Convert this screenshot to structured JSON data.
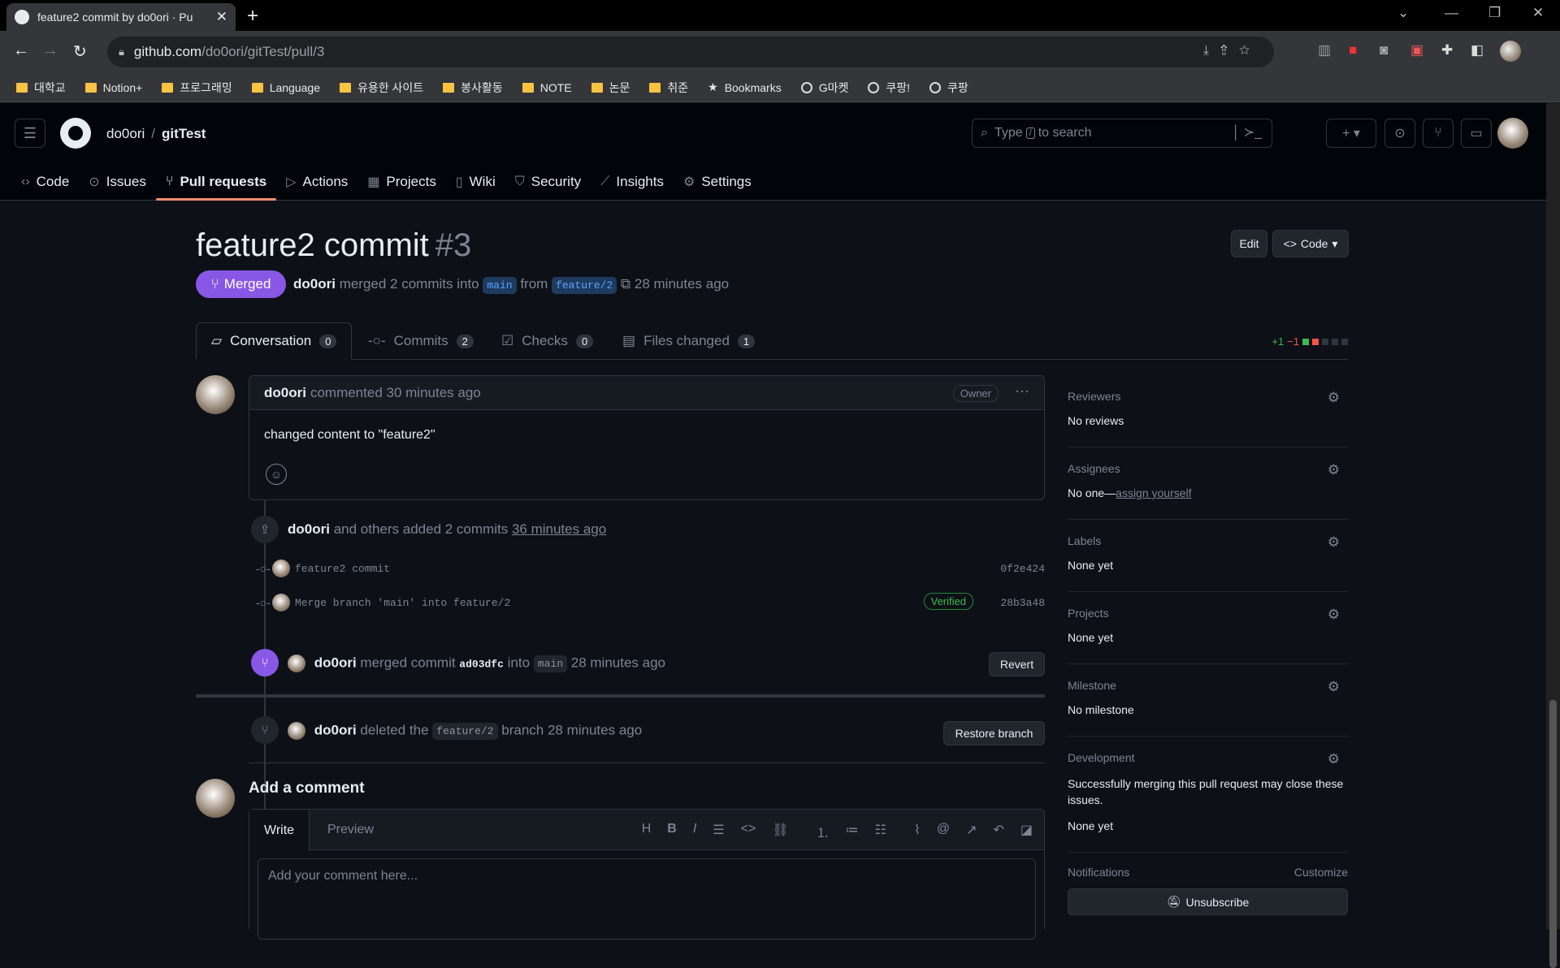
{
  "browser": {
    "tab_title": "feature2 commit by do0ori · Pu",
    "url_host": "github.com",
    "url_path": "/do0ori/gitTest/pull/3",
    "bookmarks": [
      {
        "label": "대학교",
        "icon": "folder-icon"
      },
      {
        "label": "Notion+",
        "icon": "folder-icon"
      },
      {
        "label": "프로그래밍",
        "icon": "folder-icon"
      },
      {
        "label": "Language",
        "icon": "folder-icon"
      },
      {
        "label": "유용한 사이트",
        "icon": "folder-icon"
      },
      {
        "label": "봉사활동",
        "icon": "folder-icon"
      },
      {
        "label": "NOTE",
        "icon": "folder-icon"
      },
      {
        "label": "논문",
        "icon": "folder-icon"
      },
      {
        "label": "취준",
        "icon": "folder-icon"
      },
      {
        "label": "Bookmarks",
        "icon": "star-icon"
      },
      {
        "label": "G마켓",
        "icon": "globe-icon"
      },
      {
        "label": "쿠팡!",
        "icon": "globe-icon"
      },
      {
        "label": "쿠팡",
        "icon": "globe-icon"
      }
    ]
  },
  "header": {
    "owner": "do0ori",
    "separator": "/",
    "repo": "gitTest",
    "search_placeholder_pre": "Type",
    "search_key": "/",
    "search_placeholder_post": "to search",
    "repo_tabs": [
      {
        "label": "Code",
        "icon": "code-icon"
      },
      {
        "label": "Issues",
        "icon": "issue-icon"
      },
      {
        "label": "Pull requests",
        "icon": "pull-request-icon"
      },
      {
        "label": "Actions",
        "icon": "play-icon"
      },
      {
        "label": "Projects",
        "icon": "table-icon"
      },
      {
        "label": "Wiki",
        "icon": "book-icon"
      },
      {
        "label": "Security",
        "icon": "shield-icon"
      },
      {
        "label": "Insights",
        "icon": "graph-icon"
      },
      {
        "label": "Settings",
        "icon": "gear-icon"
      }
    ]
  },
  "pr": {
    "title": "feature2 commit",
    "number": "#3",
    "edit_label": "Edit",
    "code_label": "Code",
    "state": "Merged",
    "author": "do0ori",
    "meta_merged": "merged 2 commits into",
    "base": "main",
    "meta_from": "from",
    "head": "feature/2",
    "time": "28 minutes ago",
    "tabs": [
      {
        "label": "Conversation",
        "count": "0"
      },
      {
        "label": "Commits",
        "count": "2"
      },
      {
        "label": "Checks",
        "count": "0"
      },
      {
        "label": "Files changed",
        "count": "1"
      }
    ],
    "additions": "+1",
    "deletions": "−1",
    "colors": {
      "merged": "#8957e5",
      "add": "#3fb950",
      "del": "#f85149"
    }
  },
  "comment": {
    "author": "do0ori",
    "action": "commented 30 minutes ago",
    "role": "Owner",
    "body": "changed content to \"feature2\""
  },
  "timeline": {
    "added_author": "do0ori",
    "added_text": "and others added 2 commits",
    "added_time": "36 minutes ago",
    "commits": [
      {
        "message": "feature2 commit",
        "sha": "0f2e424",
        "verified": ""
      },
      {
        "message": "Merge branch 'main' into feature/2",
        "sha": "28b3a48",
        "verified": "Verified"
      }
    ],
    "merged_author": "do0ori",
    "merged_text": "merged commit",
    "merged_sha": "ad03dfc",
    "merged_into": "into",
    "merged_base": "main",
    "merged_time": "28 minutes ago",
    "revert_label": "Revert",
    "deleted_author": "do0ori",
    "deleted_text": "deleted the",
    "deleted_branch": "feature/2",
    "deleted_time": "branch 28 minutes ago",
    "restore_label": "Restore branch"
  },
  "sidebar": {
    "sections": [
      {
        "title": "Reviewers",
        "value": "No reviews"
      },
      {
        "title": "Assignees",
        "value": "No one—",
        "link": "assign yourself"
      },
      {
        "title": "Labels",
        "value": "None yet"
      },
      {
        "title": "Projects",
        "value": "None yet"
      },
      {
        "title": "Milestone",
        "value": "No milestone"
      }
    ],
    "development_title": "Development",
    "development_text": "Successfully merging this pull request may close these issues.",
    "development_value": "None yet",
    "notifications_title": "Notifications",
    "customize": "Customize",
    "unsubscribe": "Unsubscribe"
  },
  "add_comment": {
    "title": "Add a comment",
    "write": "Write",
    "preview": "Preview",
    "placeholder": "Add your comment here..."
  }
}
